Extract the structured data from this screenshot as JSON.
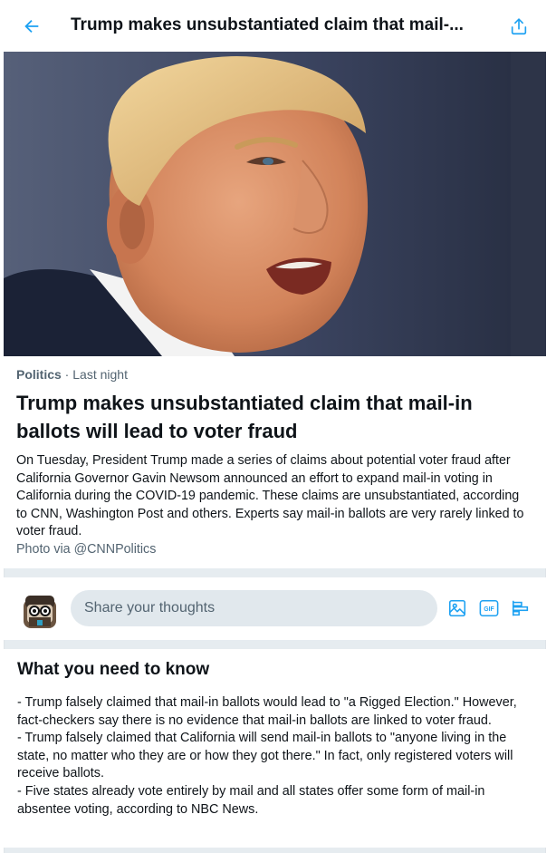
{
  "topbar": {
    "title": "Trump makes unsubstantiated claim that mail-...",
    "back_icon": "back-arrow-icon",
    "share_icon": "share-icon"
  },
  "hero": {
    "alt": "Photo of Donald Trump speaking"
  },
  "article": {
    "category": "Politics",
    "separator": " · ",
    "time": "Last night",
    "headline": "Trump makes unsubstantiated claim that mail-in ballots will lead to voter fraud",
    "summary": "On Tuesday, President Trump made a series of claims about potential voter fraud after California Governor Gavin Newsom announced an effort to expand mail-in voting in California during the COVID-19 pandemic. These claims are unsubstantiated, according to CNN, Washington Post and others. Experts say mail-in ballots are very rarely linked to voter fraud.",
    "credit": "Photo via @CNNPolitics"
  },
  "compose": {
    "placeholder": "Share your thoughts",
    "tools": [
      "image-icon",
      "gif-icon",
      "poll-icon"
    ],
    "gif_label": "GIF"
  },
  "know": {
    "title": "What you need to know",
    "bullets": [
      "- Trump falsely claimed that mail-in ballots would lead to \"a Rigged Election.\" However, fact-checkers say there is no evidence that mail-in ballots are linked to voter fraud.",
      "- Trump falsely claimed that California will send mail-in ballots to \"anyone living in the state, no matter who they are or how they got there.\" In fact, only registered voters will receive ballots.",
      "- Five states already vote entirely by mail and all states offer some form of mail-in absentee voting, according to NBC News."
    ]
  },
  "colors": {
    "accent": "#1da1f2",
    "background": "#e6ecf0",
    "secondary_text": "#536471"
  }
}
